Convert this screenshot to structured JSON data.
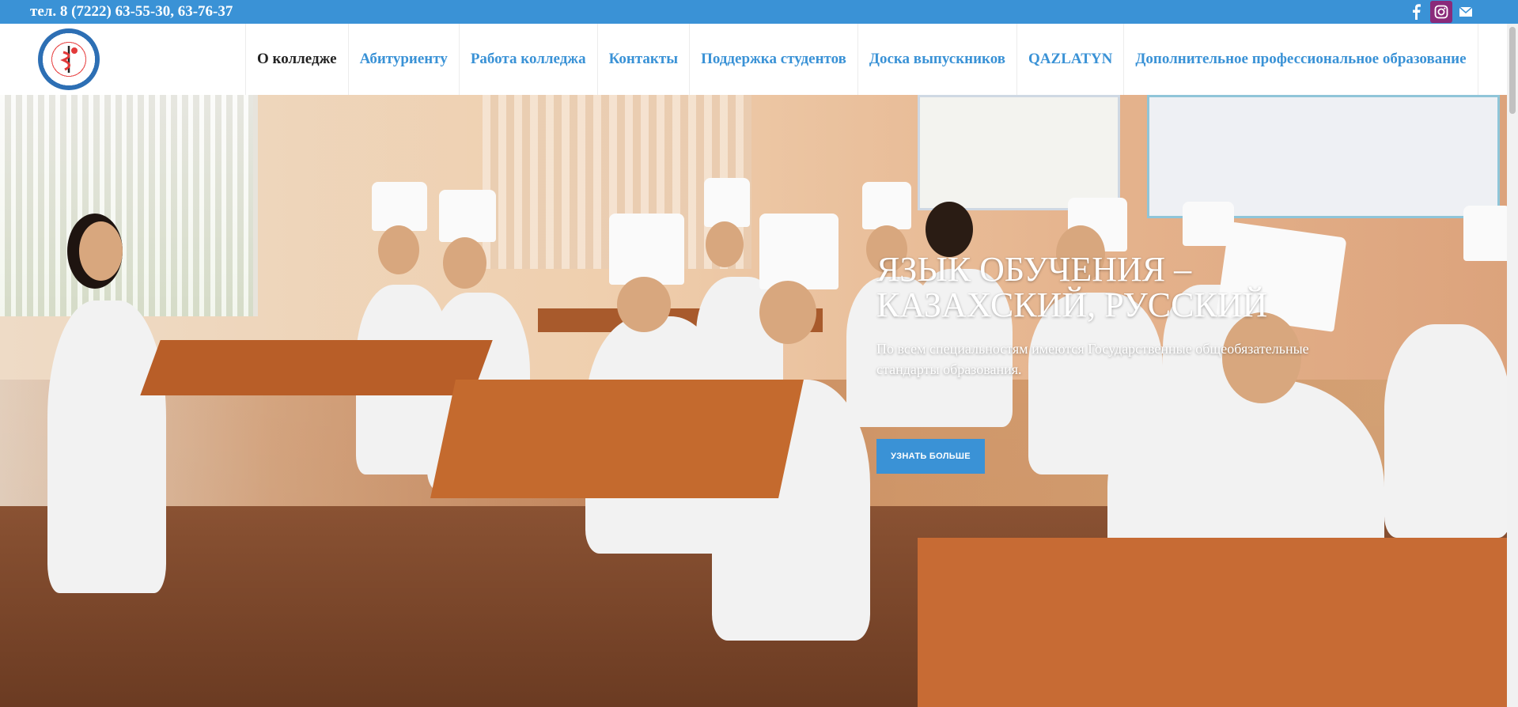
{
  "topbar": {
    "phone": "тел. 8 (7222) 63-55-30, 63-76-37",
    "social": [
      "facebook-icon",
      "instagram-icon",
      "mail-icon"
    ]
  },
  "nav": {
    "items": [
      {
        "label": "О колледже",
        "active": true
      },
      {
        "label": "Абитуриенту"
      },
      {
        "label": "Работа колледжа"
      },
      {
        "label": "Контакты"
      },
      {
        "label": "Поддержка студентов"
      },
      {
        "label": "Доска выпускников"
      },
      {
        "label": "QAZLATYN"
      },
      {
        "label": "Дополнительное профессиональное образование"
      }
    ]
  },
  "hero": {
    "title": "ЯЗЫК ОБУЧЕНИЯ – КАЗАХСКИЙ, РУССКИЙ",
    "subtitle": "По всем специальностям имеются Государственные общеобязательные стандарты образования.",
    "button": "УЗНАТЬ БОЛЬШЕ"
  },
  "colors": {
    "accent": "#3a92d6",
    "active_nav": "#222222"
  }
}
